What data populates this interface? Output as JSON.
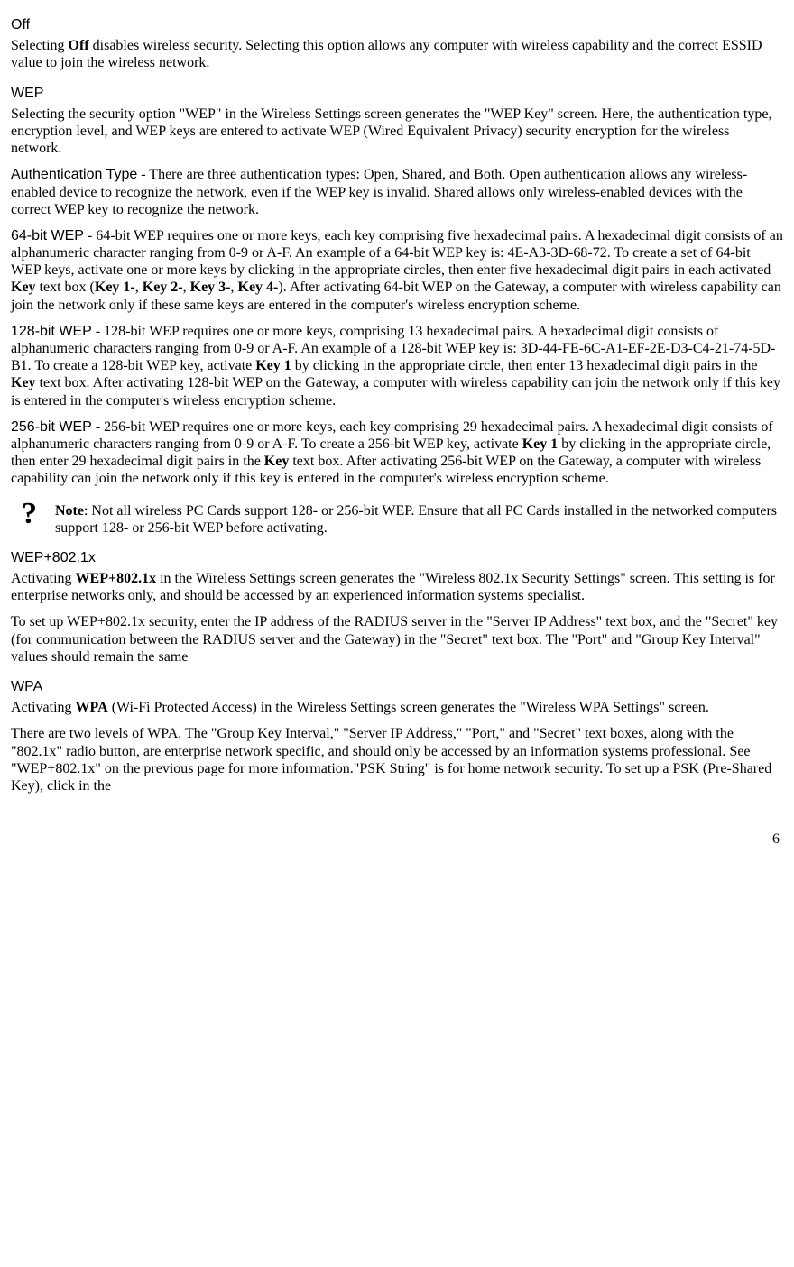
{
  "off": {
    "title": "Off",
    "p1a": "Selecting ",
    "p1b": "Off",
    "p1c": " disables wireless security. Selecting this option allows any computer with wireless capability and the correct ESSID value to join the wireless network."
  },
  "wep": {
    "title": "WEP",
    "p1": "Selecting the security option \"WEP\" in the Wireless Settings screen generates the \"WEP Key\" screen. Here, the authentication type, encryption level, and WEP keys are entered to activate WEP (Wired Equivalent Privacy) security encryption for the wireless network.",
    "auth_lead": "Authentication Type",
    "auth_dash": " - ",
    "auth_body": "There are three authentication types: Open, Shared, and Both. Open authentication allows any wireless-enabled device to recognize the network, even if the WEP key is invalid. Shared allows only wireless-enabled devices with the correct WEP key to recognize the network.",
    "b64_lead": "64-bit WEP",
    "b64_dash": " - ",
    "b64_a": "64-bit WEP requires one or more keys, each key comprising five hexadecimal pairs. A hexadecimal digit consists of an alphanumeric character ranging from 0-9 or A-F. An example of a 64-bit WEP key is: 4E-A3-3D-68-72. To create a set of 64-bit WEP keys, activate one or more keys by clicking in the appropriate circles, then enter five hexadecimal digit pairs in each activated ",
    "b64_key": "Key",
    "b64_b": " text box (",
    "b64_k1": "Key 1-",
    "b64_c": ", ",
    "b64_k2": "Key 2-",
    "b64_d": ", ",
    "b64_k3": "Key 3-",
    "b64_e": ", ",
    "b64_k4": "Key 4-",
    "b64_f": "). After activating 64-bit WEP on the Gateway, a computer with wireless capability can join the network only if these same keys are entered in the computer's wireless encryption scheme.",
    "b128_lead": "128-bit WEP",
    "b128_dash": " - ",
    "b128_a": "128-bit WEP requires one or more keys, comprising 13 hexadecimal pairs. A hexadecimal digit consists of alphanumeric characters ranging from 0-9 or A-F. An example of a 128-bit WEP key is: 3D-44-FE-6C-A1-EF-2E-D3-C4-21-74-5D-B1. To create a 128-bit WEP key, activate ",
    "b128_k1": "Key 1",
    "b128_b": " by clicking in the appropriate circle, then enter 13 hexadecimal digit pairs in the ",
    "b128_key": "Key",
    "b128_c": " text box. After activating 128-bit WEP on the Gateway, a computer with wireless capability can join the network only if this key is entered in the computer's wireless encryption scheme.",
    "b256_lead": "256-bit WEP",
    "b256_dash": " - ",
    "b256_a": "256-bit WEP requires one or more keys, each key comprising 29 hexadecimal pairs. A hexadecimal digit consists of alphanumeric characters ranging from 0-9 or A-F. To create a 256-bit WEP key, activate ",
    "b256_k1": "Key 1",
    "b256_b": " by clicking in the appropriate circle, then enter 29 hexadecimal digit pairs in the ",
    "b256_key": "Key",
    "b256_c": " text box. After activating 256-bit WEP on the Gateway, a computer with wireless capability can join the network only if this key is entered in the computer's wireless encryption scheme."
  },
  "note": {
    "icon": "?",
    "lead": "Note",
    "body": ": Not all wireless PC Cards support 128- or 256-bit WEP. Ensure that all PC Cards installed in the networked computers support 128- or 256-bit WEP before activating."
  },
  "wep8021x": {
    "title": "WEP+802.1x",
    "p1a": "Activating ",
    "p1b": "WEP+802.1x",
    "p1c": " in the Wireless Settings screen generates the \"Wireless 802.1x Security Settings\" screen. This setting is for enterprise networks only, and should be accessed by an experienced information systems specialist.",
    "p2": "To set up WEP+802.1x security, enter the IP address of the RADIUS server in the \"Server IP Address\" text box, and the \"Secret\" key (for communication between the RADIUS server and the Gateway) in the \"Secret\" text box. The \"Port\" and \"Group Key Interval\" values should remain the same"
  },
  "wpa": {
    "title": "WPA",
    "p1a": "Activating ",
    "p1b": "WPA",
    "p1c": " (Wi-Fi Protected Access) in the Wireless Settings screen generates the \"Wireless WPA Settings\" screen.",
    "p2": "There are two levels of WPA. The \"Group Key Interval,\" \"Server IP Address,\" \"Port,\" and \"Secret\" text boxes, along with the \"802.1x\" radio button, are enterprise network specific, and should only be accessed by an information systems professional. See \"WEP+802.1x\" on the previous page for more information.\"PSK String\" is for home network security. To set up a PSK (Pre-Shared Key), click in the"
  },
  "page_number": "6"
}
